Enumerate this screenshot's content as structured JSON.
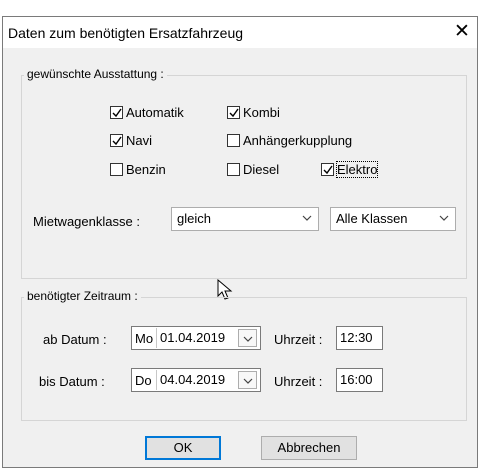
{
  "window": {
    "title": "Daten zum benötigten Ersatzfahrzeug",
    "close_glyph": "✕"
  },
  "ausstattung": {
    "legend": "gewünschte Ausstattung :",
    "checkboxes": [
      {
        "label": "Automatik",
        "checked": true
      },
      {
        "label": "Kombi",
        "checked": true
      },
      {
        "label": "Navi",
        "checked": true
      },
      {
        "label": "Anhängerkupplung",
        "checked": false
      },
      {
        "label": "Benzin",
        "checked": false
      },
      {
        "label": "Diesel",
        "checked": false
      },
      {
        "label": "Elektro",
        "checked": true
      }
    ],
    "mietwagenklasse_label": "Mietwagenklasse :",
    "mietwagenklasse_value": "gleich",
    "klassen_value": "Alle Klassen"
  },
  "zeitraum": {
    "legend": "benötigter Zeitraum :",
    "ab": {
      "label": "ab Datum :",
      "weekday": "Mo",
      "date": "01.04.2019",
      "time_label": "Uhrzeit :",
      "time": "12:30"
    },
    "bis": {
      "label": "bis Datum :",
      "weekday": "Do",
      "date": "04.04.2019",
      "time_label": "Uhrzeit :",
      "time": "16:00"
    }
  },
  "buttons": {
    "ok": "OK",
    "cancel": "Abbrechen"
  },
  "icons": {
    "checkmark": "check-icon",
    "dropdown": "chevron-down-icon",
    "cursor": "mouse-pointer-icon",
    "close": "close-icon"
  }
}
